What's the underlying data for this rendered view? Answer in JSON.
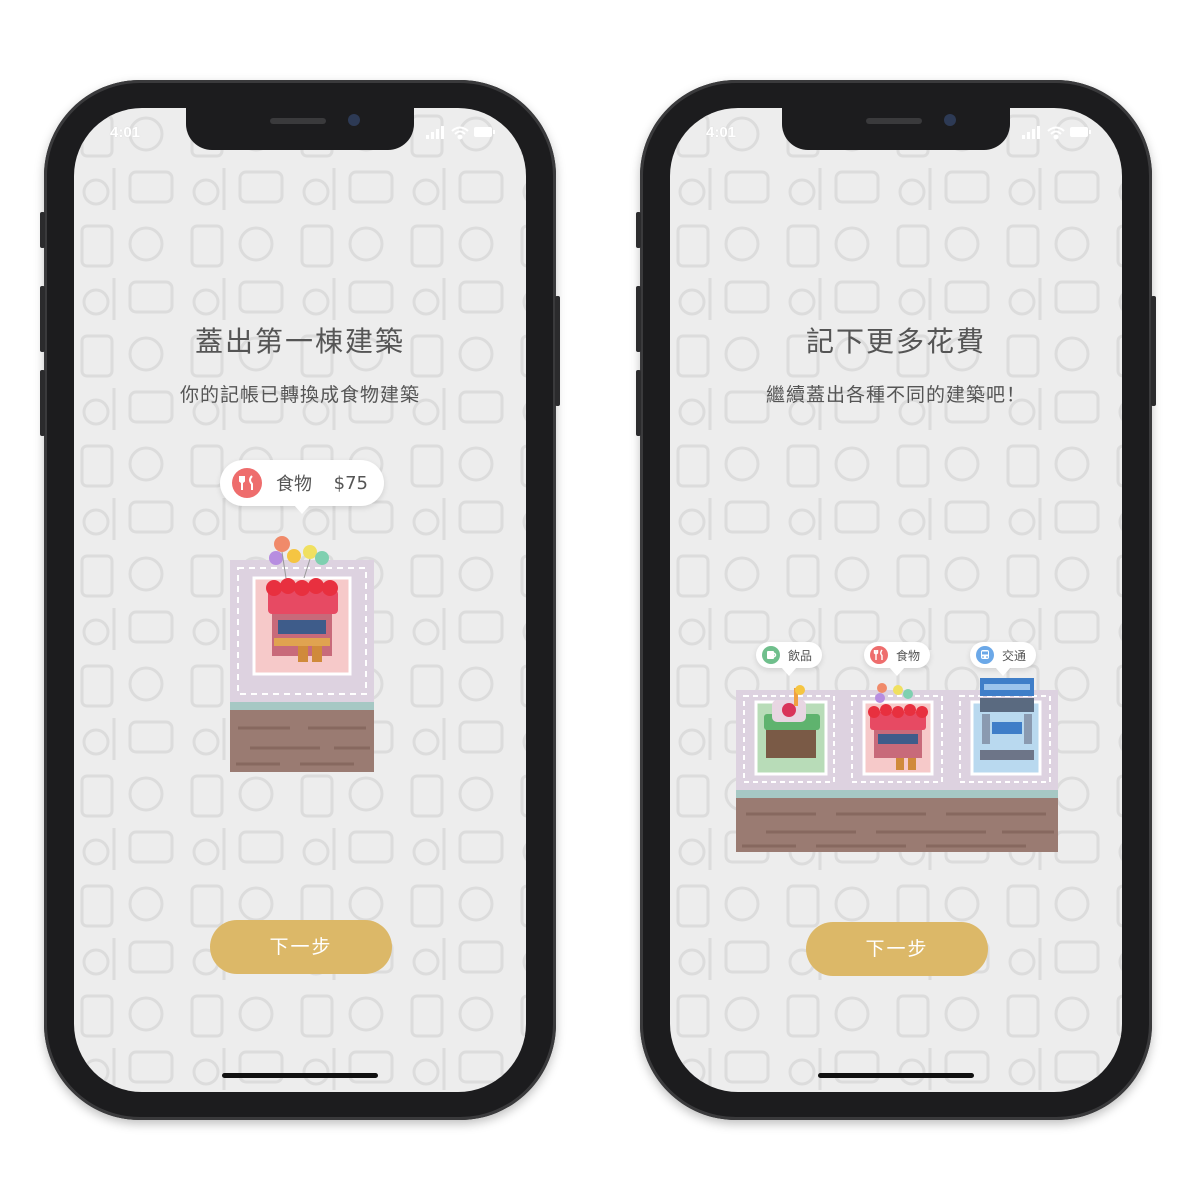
{
  "status_bar": {
    "time": "4:01"
  },
  "screens": [
    {
      "title": "蓋出第一棟建築",
      "subtitle": "你的記帳已轉換成食物建築",
      "tag": {
        "category": "食物",
        "amount": "$75",
        "icon": "food-icon"
      },
      "button_label": "下一步"
    },
    {
      "title": "記下更多花費",
      "subtitle": "繼續蓋出各種不同的建築吧！",
      "tags": [
        {
          "category": "飲品",
          "icon": "drink-icon"
        },
        {
          "category": "食物",
          "icon": "food-icon"
        },
        {
          "category": "交通",
          "icon": "transport-icon"
        }
      ],
      "button_label": "下一步"
    }
  ],
  "colors": {
    "button": "#dcb868",
    "food": "#ee6d6d",
    "drink": "#6fbf8c",
    "transport": "#6ba8e8",
    "ground": "#ddd2e0",
    "brick": "#9a7b72"
  }
}
